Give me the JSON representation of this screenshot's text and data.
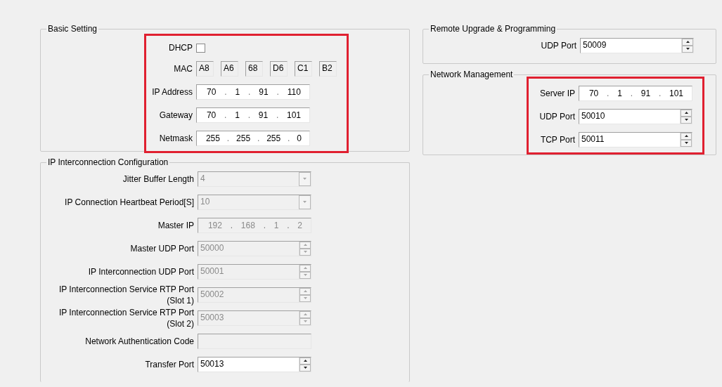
{
  "left_column": {
    "sections": [
      {
        "kind": "basic",
        "title": "Basic Setting",
        "highlighted": true,
        "fields": [
          {
            "kind": "checkbox",
            "label": "DHCP",
            "checked": false
          },
          {
            "kind": "mac",
            "label": "MAC",
            "octets": [
              "A8",
              "A6",
              "68",
              "D6",
              "C1",
              "B2"
            ]
          },
          {
            "kind": "ip",
            "label": "IP Address",
            "octets": [
              "70",
              "1",
              "91",
              "110"
            ],
            "separator": ".",
            "disabled": false
          },
          {
            "kind": "ip",
            "label": "Gateway",
            "octets": [
              "70",
              "1",
              "91",
              "101"
            ],
            "separator": ".",
            "disabled": false
          },
          {
            "kind": "ip",
            "label": "Netmask",
            "octets": [
              "255",
              "255",
              "255",
              "0"
            ],
            "separator": ".",
            "disabled": false
          }
        ]
      },
      {
        "kind": "interconnection",
        "title": "IP Interconnection Configuration",
        "highlighted": false,
        "fields": [
          {
            "kind": "combo",
            "label": "Jitter Buffer Length",
            "value": "4",
            "disabled": true
          },
          {
            "kind": "combo",
            "label": "IP Connection Heartbeat Period[S]",
            "value": "10",
            "disabled": true
          },
          {
            "kind": "ip",
            "label": "Master IP",
            "octets": [
              "192",
              "168",
              "1",
              "2"
            ],
            "separator": ".",
            "disabled": true
          },
          {
            "kind": "spin",
            "label": "Master UDP Port",
            "value": "50000",
            "disabled": true
          },
          {
            "kind": "spin",
            "label": "IP Interconnection UDP Port",
            "value": "50001",
            "disabled": true
          },
          {
            "kind": "spin",
            "label": "IP Interconnection Service RTP Port\n(Slot 1)",
            "value": "50002",
            "disabled": true
          },
          {
            "kind": "spin",
            "label": "IP Interconnection Service RTP Port\n(Slot 2)",
            "value": "50003",
            "disabled": true
          },
          {
            "kind": "text",
            "label": "Network Authentication Code",
            "disabled": true
          },
          {
            "kind": "spin",
            "label": "Transfer Port",
            "value": "50013",
            "disabled": false
          }
        ]
      }
    ]
  },
  "right_column": {
    "sections": [
      {
        "kind": "upgrade",
        "title": "Remote Upgrade & Programming",
        "highlighted": false,
        "fields": [
          {
            "kind": "spin",
            "label": "UDP Port",
            "value": "50009",
            "disabled": false
          }
        ]
      },
      {
        "kind": "management",
        "title": "Network Management",
        "highlighted": true,
        "fields": [
          {
            "kind": "ip",
            "label": "Server IP",
            "octets": [
              "70",
              "1",
              "91",
              "101"
            ],
            "separator": ".",
            "disabled": false
          },
          {
            "kind": "spin",
            "label": "UDP Port",
            "value": "50010",
            "disabled": false
          },
          {
            "kind": "spin",
            "label": "TCP Port",
            "value": "50011",
            "disabled": false
          }
        ]
      }
    ]
  }
}
